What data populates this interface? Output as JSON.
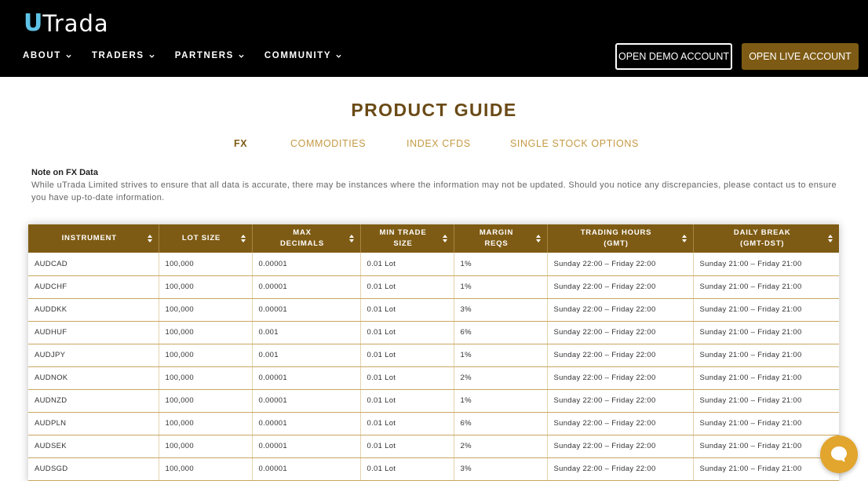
{
  "header": {
    "logo_u": "U",
    "logo_rest": "Trada",
    "nav": [
      {
        "label": "ABOUT"
      },
      {
        "label": "TRADERS"
      },
      {
        "label": "PARTNERS"
      },
      {
        "label": "COMMUNITY"
      }
    ],
    "demo_button": "OPEN DEMO ACCOUNT",
    "live_button": "OPEN LIVE ACCOUNT"
  },
  "page": {
    "title": "PRODUCT GUIDE",
    "tabs": [
      {
        "label": "FX"
      },
      {
        "label": "COMMODITIES"
      },
      {
        "label": "INDEX CFDS"
      },
      {
        "label": "SINGLE STOCK OPTIONS"
      }
    ],
    "note_title": "Note on FX Data",
    "note_text": "While uTrada Limited strives to ensure that all data is accurate, there may be instances where the information may not be updated. Should you notice any discrepancies, please contact us to ensure you have up-to-date information."
  },
  "table": {
    "headers": [
      {
        "line1": "INSTRUMENT",
        "line2": ""
      },
      {
        "line1": "LOT SIZE",
        "line2": ""
      },
      {
        "line1": "MAX",
        "line2": "DECIMALS"
      },
      {
        "line1": "MIN TRADE",
        "line2": "SIZE"
      },
      {
        "line1": "MARGIN",
        "line2": "REQS"
      },
      {
        "line1": "TRADING HOURS",
        "line2": "(GMT)"
      },
      {
        "line1": "DAILY BREAK",
        "line2": "(GMT-DST)"
      }
    ],
    "rows": [
      [
        "AUDCAD",
        "100,000",
        "0.00001",
        "0.01 Lot",
        "1%",
        "Sunday 22:00 – Friday 22:00",
        "Sunday 21:00 – Friday 21:00"
      ],
      [
        "AUDCHF",
        "100,000",
        "0.00001",
        "0.01 Lot",
        "1%",
        "Sunday 22:00 – Friday 22:00",
        "Sunday 21:00 – Friday 21:00"
      ],
      [
        "AUDDKK",
        "100,000",
        "0.00001",
        "0.01 Lot",
        "3%",
        "Sunday 22:00 – Friday 22:00",
        "Sunday 21:00 – Friday 21:00"
      ],
      [
        "AUDHUF",
        "100,000",
        "0.001",
        "0.01 Lot",
        "6%",
        "Sunday 22:00 – Friday 22:00",
        "Sunday 21:00 – Friday 21:00"
      ],
      [
        "AUDJPY",
        "100,000",
        "0.001",
        "0.01 Lot",
        "1%",
        "Sunday 22:00 – Friday 22:00",
        "Sunday 21:00 – Friday 21:00"
      ],
      [
        "AUDNOK",
        "100,000",
        "0.00001",
        "0.01 Lot",
        "2%",
        "Sunday 22:00 – Friday 22:00",
        "Sunday 21:00 – Friday 21:00"
      ],
      [
        "AUDNZD",
        "100,000",
        "0.00001",
        "0.01 Lot",
        "1%",
        "Sunday 22:00 – Friday 22:00",
        "Sunday 21:00 – Friday 21:00"
      ],
      [
        "AUDPLN",
        "100,000",
        "0.00001",
        "0.01 Lot",
        "6%",
        "Sunday 22:00 – Friday 22:00",
        "Sunday 21:00 – Friday 21:00"
      ],
      [
        "AUDSEK",
        "100,000",
        "0.00001",
        "0.01 Lot",
        "2%",
        "Sunday 22:00 – Friday 22:00",
        "Sunday 21:00 – Friday 21:00"
      ],
      [
        "AUDSGD",
        "100,000",
        "0.00001",
        "0.01 Lot",
        "3%",
        "Sunday 22:00 – Friday 22:00",
        "Sunday 21:00 – Friday 21:00"
      ]
    ]
  },
  "icons": {
    "nav_chevron": "chevron-down-icon",
    "sort": "sort-icon",
    "chat": "chat-bubble-icon"
  },
  "colors": {
    "header_bg": "#000000",
    "brand_gold": "#7e5b14",
    "tab_gold": "#c49a44",
    "logo_blue": "#5ec3e6",
    "chat_orange": "#e2a52d"
  }
}
